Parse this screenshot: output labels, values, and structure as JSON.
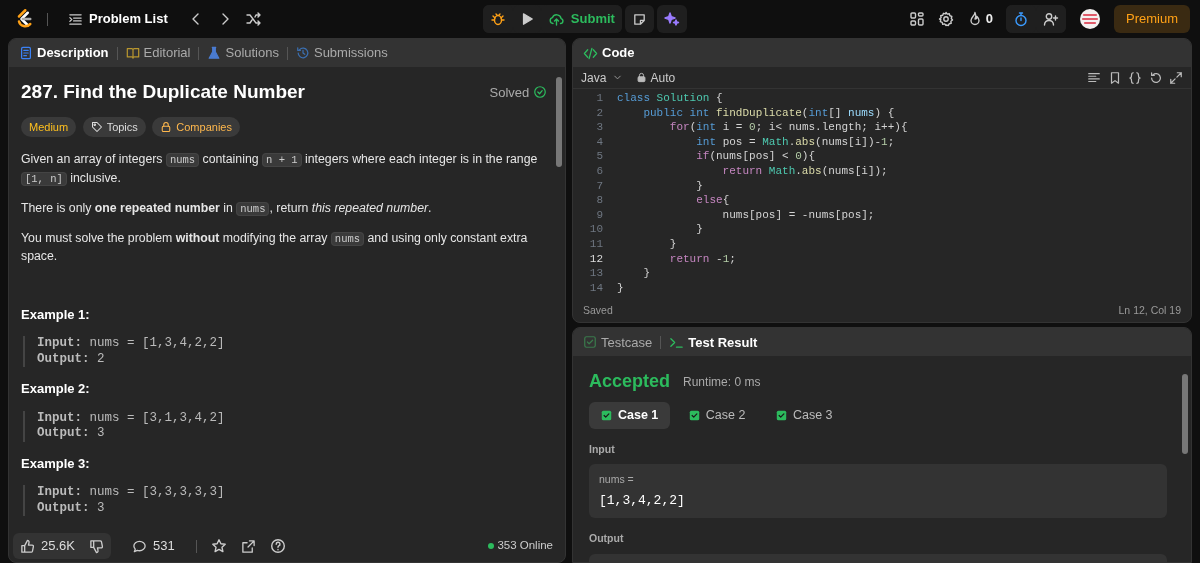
{
  "topbar": {
    "problem_list": "Problem List",
    "submit": "Submit",
    "streak": "0",
    "premium": "Premium"
  },
  "description_panel": {
    "tabs": [
      {
        "label": "Description",
        "selected": true
      },
      {
        "label": "Editorial",
        "selected": false
      },
      {
        "label": "Solutions",
        "selected": false
      },
      {
        "label": "Submissions",
        "selected": false
      }
    ],
    "title": "287. Find the Duplicate Number",
    "status": "Solved",
    "tags": [
      {
        "label": "Medium",
        "kind": "difficulty"
      },
      {
        "label": "Topics",
        "kind": "topics"
      },
      {
        "label": "Companies",
        "kind": "companies"
      }
    ],
    "paragraphs": [
      [
        {
          "kind": "text",
          "text": "Given an array of integers "
        },
        {
          "kind": "code",
          "text": "nums"
        },
        {
          "kind": "text",
          "text": " containing "
        },
        {
          "kind": "code",
          "text": "n + 1"
        },
        {
          "kind": "text",
          "text": " integers where each integer is in the range "
        },
        {
          "kind": "code",
          "text": "[1, n]"
        },
        {
          "kind": "text",
          "text": " inclusive."
        }
      ],
      [
        {
          "kind": "text",
          "text": "There is only **one repeated number** in "
        },
        {
          "kind": "code",
          "text": "nums"
        },
        {
          "kind": "text",
          "text": ", return *this repeated number*."
        }
      ],
      [
        {
          "kind": "text",
          "text": "You must solve the problem **without** modifying the array "
        },
        {
          "kind": "code",
          "text": "nums"
        },
        {
          "kind": "text",
          "text": " and using only constant extra space."
        }
      ]
    ],
    "examples": [
      {
        "title": "Example 1:",
        "lines": [
          "**Input:** nums = [1,3,4,2,2]",
          "**Output:** 2"
        ]
      },
      {
        "title": "Example 2:",
        "lines": [
          "**Input:** nums = [3,1,3,4,2]",
          "**Output:** 3"
        ]
      },
      {
        "title": "Example 3:",
        "lines": [
          "**Input:** nums = [3,3,3,3,3]",
          "**Output:** 3"
        ]
      }
    ],
    "footer": {
      "likes": "25.6K",
      "comments": "531",
      "online": "353 Online"
    }
  },
  "code_panel": {
    "title": "Code",
    "language": "Java",
    "mode": "Auto",
    "lines": [
      {
        "number": "1",
        "current": false,
        "tokens": [
          {
            "t": "class",
            "kind": "kw"
          },
          {
            "t": " Solution",
            "kind": "cls"
          },
          {
            "t": " {",
            "kind": "plain"
          }
        ]
      },
      {
        "number": "2",
        "current": false,
        "tokens": [
          {
            "t": "    public int",
            "kind": "kw"
          },
          {
            "t": " findDuplicate",
            "kind": "fn"
          },
          {
            "t": "(",
            "kind": "plain"
          },
          {
            "t": "int",
            "kind": "kw"
          },
          {
            "t": "[]",
            "kind": "plain"
          },
          {
            "t": " nums",
            "kind": "var"
          },
          {
            "t": ") {",
            "kind": "plain"
          }
        ]
      },
      {
        "number": "3",
        "current": false,
        "tokens": [
          {
            "t": "        for",
            "kind": "ctl"
          },
          {
            "t": "(",
            "kind": "plain"
          },
          {
            "t": "int",
            "kind": "kw"
          },
          {
            "t": " i = ",
            "kind": "plain"
          },
          {
            "t": "0",
            "kind": "num"
          },
          {
            "t": "; i< nums.length; i++){",
            "kind": "plain"
          }
        ]
      },
      {
        "number": "4",
        "current": false,
        "tokens": [
          {
            "t": "            int",
            "kind": "kw"
          },
          {
            "t": " pos = ",
            "kind": "plain"
          },
          {
            "t": "Math",
            "kind": "cls"
          },
          {
            "t": ".",
            "kind": "plain"
          },
          {
            "t": "abs",
            "kind": "fn"
          },
          {
            "t": "(nums[i])-",
            "kind": "plain"
          },
          {
            "t": "1",
            "kind": "num"
          },
          {
            "t": ";",
            "kind": "plain"
          }
        ]
      },
      {
        "number": "5",
        "current": false,
        "tokens": [
          {
            "t": "            if",
            "kind": "ctl"
          },
          {
            "t": "(nums[pos] < ",
            "kind": "plain"
          },
          {
            "t": "0",
            "kind": "num"
          },
          {
            "t": "){",
            "kind": "plain"
          }
        ]
      },
      {
        "number": "6",
        "current": false,
        "tokens": [
          {
            "t": "                return",
            "kind": "ctl"
          },
          {
            "t": " Math",
            "kind": "cls"
          },
          {
            "t": ".",
            "kind": "plain"
          },
          {
            "t": "abs",
            "kind": "fn"
          },
          {
            "t": "(nums[i]);",
            "kind": "plain"
          }
        ]
      },
      {
        "number": "7",
        "current": false,
        "tokens": [
          {
            "t": "            }",
            "kind": "plain"
          }
        ]
      },
      {
        "number": "8",
        "current": false,
        "tokens": [
          {
            "t": "            else",
            "kind": "ctl"
          },
          {
            "t": "{",
            "kind": "plain"
          }
        ]
      },
      {
        "number": "9",
        "current": false,
        "tokens": [
          {
            "t": "                nums[pos] = -nums[pos];",
            "kind": "plain"
          }
        ]
      },
      {
        "number": "10",
        "current": false,
        "tokens": [
          {
            "t": "            }",
            "kind": "plain"
          }
        ]
      },
      {
        "number": "11",
        "current": false,
        "tokens": [
          {
            "t": "        }",
            "kind": "plain"
          }
        ]
      },
      {
        "number": "12",
        "current": true,
        "tokens": [
          {
            "t": "        return",
            "kind": "ctl"
          },
          {
            "t": " -",
            "kind": "plain"
          },
          {
            "t": "1",
            "kind": "num"
          },
          {
            "t": ";",
            "kind": "plain"
          }
        ]
      },
      {
        "number": "13",
        "current": false,
        "tokens": [
          {
            "t": "    }",
            "kind": "plain"
          }
        ]
      },
      {
        "number": "14",
        "current": false,
        "tokens": [
          {
            "t": "}",
            "kind": "plain"
          }
        ]
      }
    ],
    "status": "Saved",
    "cursor": "Ln 12, Col 19"
  },
  "test_panel": {
    "tabs": [
      {
        "label": "Testcase",
        "selected": false
      },
      {
        "label": "Test Result",
        "selected": true
      }
    ],
    "verdict": "Accepted",
    "runtime": "Runtime: 0 ms",
    "cases": [
      {
        "label": "Case 1",
        "selected": true,
        "passed": true
      },
      {
        "label": "Case 2",
        "selected": false,
        "passed": true
      },
      {
        "label": "Case 3",
        "selected": false,
        "passed": true
      }
    ],
    "input_label": "Input",
    "input_name": "nums =",
    "input_value": "[1,3,4,2,2]",
    "output_label": "Output"
  }
}
